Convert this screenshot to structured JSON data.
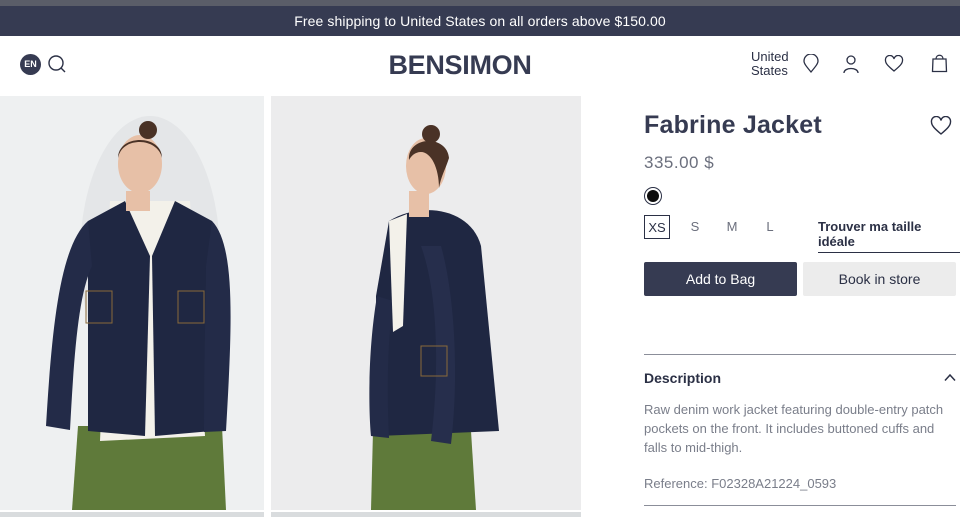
{
  "announcement": "Free shipping to United States on all orders above $150.00",
  "header": {
    "language": "EN",
    "logo": "BENSIMON",
    "country_line1": "United",
    "country_line2": "States"
  },
  "product": {
    "title": "Fabrine Jacket",
    "price": "335.00 $",
    "color": "#0d0d0d",
    "sizes": [
      "XS",
      "S",
      "M",
      "L"
    ],
    "selected_size": "XS",
    "size_guide": "Trouver ma taille idéale",
    "add_to_bag": "Add to Bag",
    "book_in_store": "Book in store"
  },
  "description": {
    "title": "Description",
    "text": "Raw denim work jacket featuring double-entry patch pockets on the front. It includes buttoned cuffs and falls to mid-thigh.",
    "reference": "Reference: F02328A21224_0593"
  },
  "colors": {
    "brand": "#363b52",
    "secondary_button": "#ececec",
    "denim": "#1f2742",
    "skirt": "#5f7a3a"
  }
}
